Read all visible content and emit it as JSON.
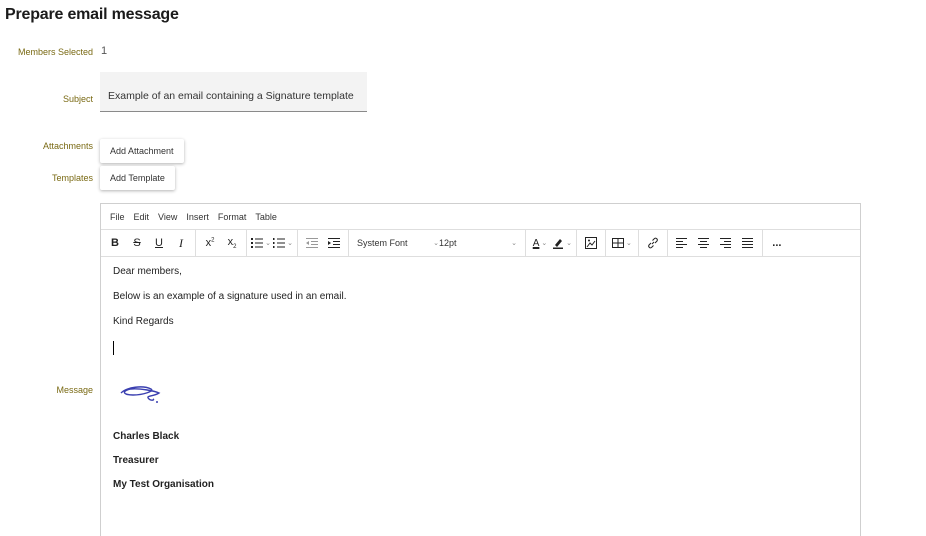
{
  "page": {
    "title": "Prepare email message"
  },
  "form": {
    "members_selected_label": "Members Selected",
    "members_selected_value": "1",
    "subject_label": "Subject",
    "subject_value": "Example of an email containing a Signature template",
    "attachments_label": "Attachments",
    "add_attachment_label": "Add Attachment",
    "templates_label": "Templates",
    "add_template_label": "Add Template",
    "message_label": "Message"
  },
  "editor": {
    "menu": [
      "File",
      "Edit",
      "View",
      "Insert",
      "Format",
      "Table"
    ],
    "toolbar": {
      "font_family": "System Font",
      "font_size": "12pt",
      "more_label": "..."
    },
    "content": {
      "lines": [
        "Dear members,",
        "Below is an example of a signature used in an email.",
        "Kind Regards"
      ],
      "signature": {
        "name": "Charles Black",
        "role": "Treasurer",
        "organisation": "My Test Organisation"
      }
    }
  },
  "colors": {
    "label": "#7a6a14",
    "signature_ink": "#3a3fb0"
  }
}
